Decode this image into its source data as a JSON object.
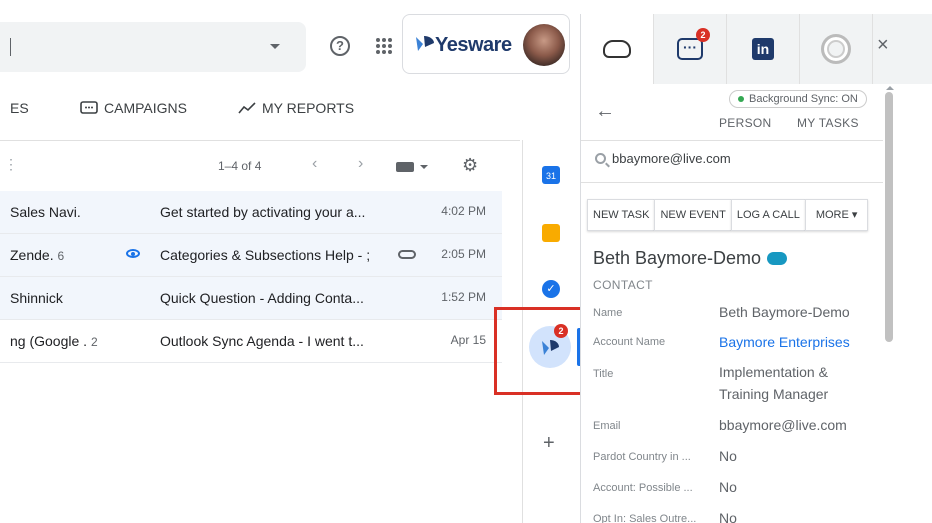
{
  "header": {
    "help_icon_glyph": "?",
    "brand_name": "Yesware"
  },
  "nav": {
    "partial_tab": "ES",
    "campaigns": "CAMPAIGNS",
    "reports": "MY REPORTS"
  },
  "toolbar": {
    "page_range": "1–4 of 4",
    "prev": "‹",
    "next": "›",
    "left_glyph": "⋮"
  },
  "emails": [
    {
      "sender": "Sales Navi.",
      "count": "",
      "subject": "Get started by activating your a...",
      "time": "4:02 PM"
    },
    {
      "sender": "Zende.",
      "count": "6",
      "subject": "Categories & Subsections Help - ;",
      "time": "2:05 PM"
    },
    {
      "sender": "Shinnick",
      "count": "",
      "subject": "Quick Question - Adding Conta...",
      "time": "1:52 PM"
    },
    {
      "sender": "ng (Google .",
      "count": "2",
      "subject": "Outlook Sync Agenda - I went t...",
      "time": "Apr 15"
    }
  ],
  "rail": {
    "calendar_label": "31",
    "yesware_badge": "2",
    "plus": "+"
  },
  "panel": {
    "chat_badge": "2",
    "linkedin_label": "in",
    "close": "×",
    "sync_status": "Background Sync: ON",
    "person_link": "PERSON",
    "tasks_link": "MY TASKS",
    "search_value": "bbaymore@live.com",
    "actions": [
      "NEW TASK",
      "NEW EVENT",
      "LOG A CALL",
      "MORE ▾"
    ],
    "contact_name": "Beth Baymore-Demo",
    "contact_type": "CONTACT",
    "fields": [
      {
        "label": "Name",
        "value": "Beth Baymore-Demo"
      },
      {
        "label": "Account Name",
        "value": "Baymore Enterprises"
      },
      {
        "label": "Title",
        "value": "Implementation & Training Manager"
      },
      {
        "label": "Email",
        "value": "bbaymore@live.com"
      },
      {
        "label": "Pardot Country in ...",
        "value": "No"
      },
      {
        "label": "Account: Possible ...",
        "value": "No"
      },
      {
        "label": "Opt In: Sales Outre...",
        "value": "No"
      }
    ]
  },
  "colors": {
    "accent": "#1a73e8",
    "highlight": "#d93025",
    "yesware_navy": "#1f3a6b"
  }
}
